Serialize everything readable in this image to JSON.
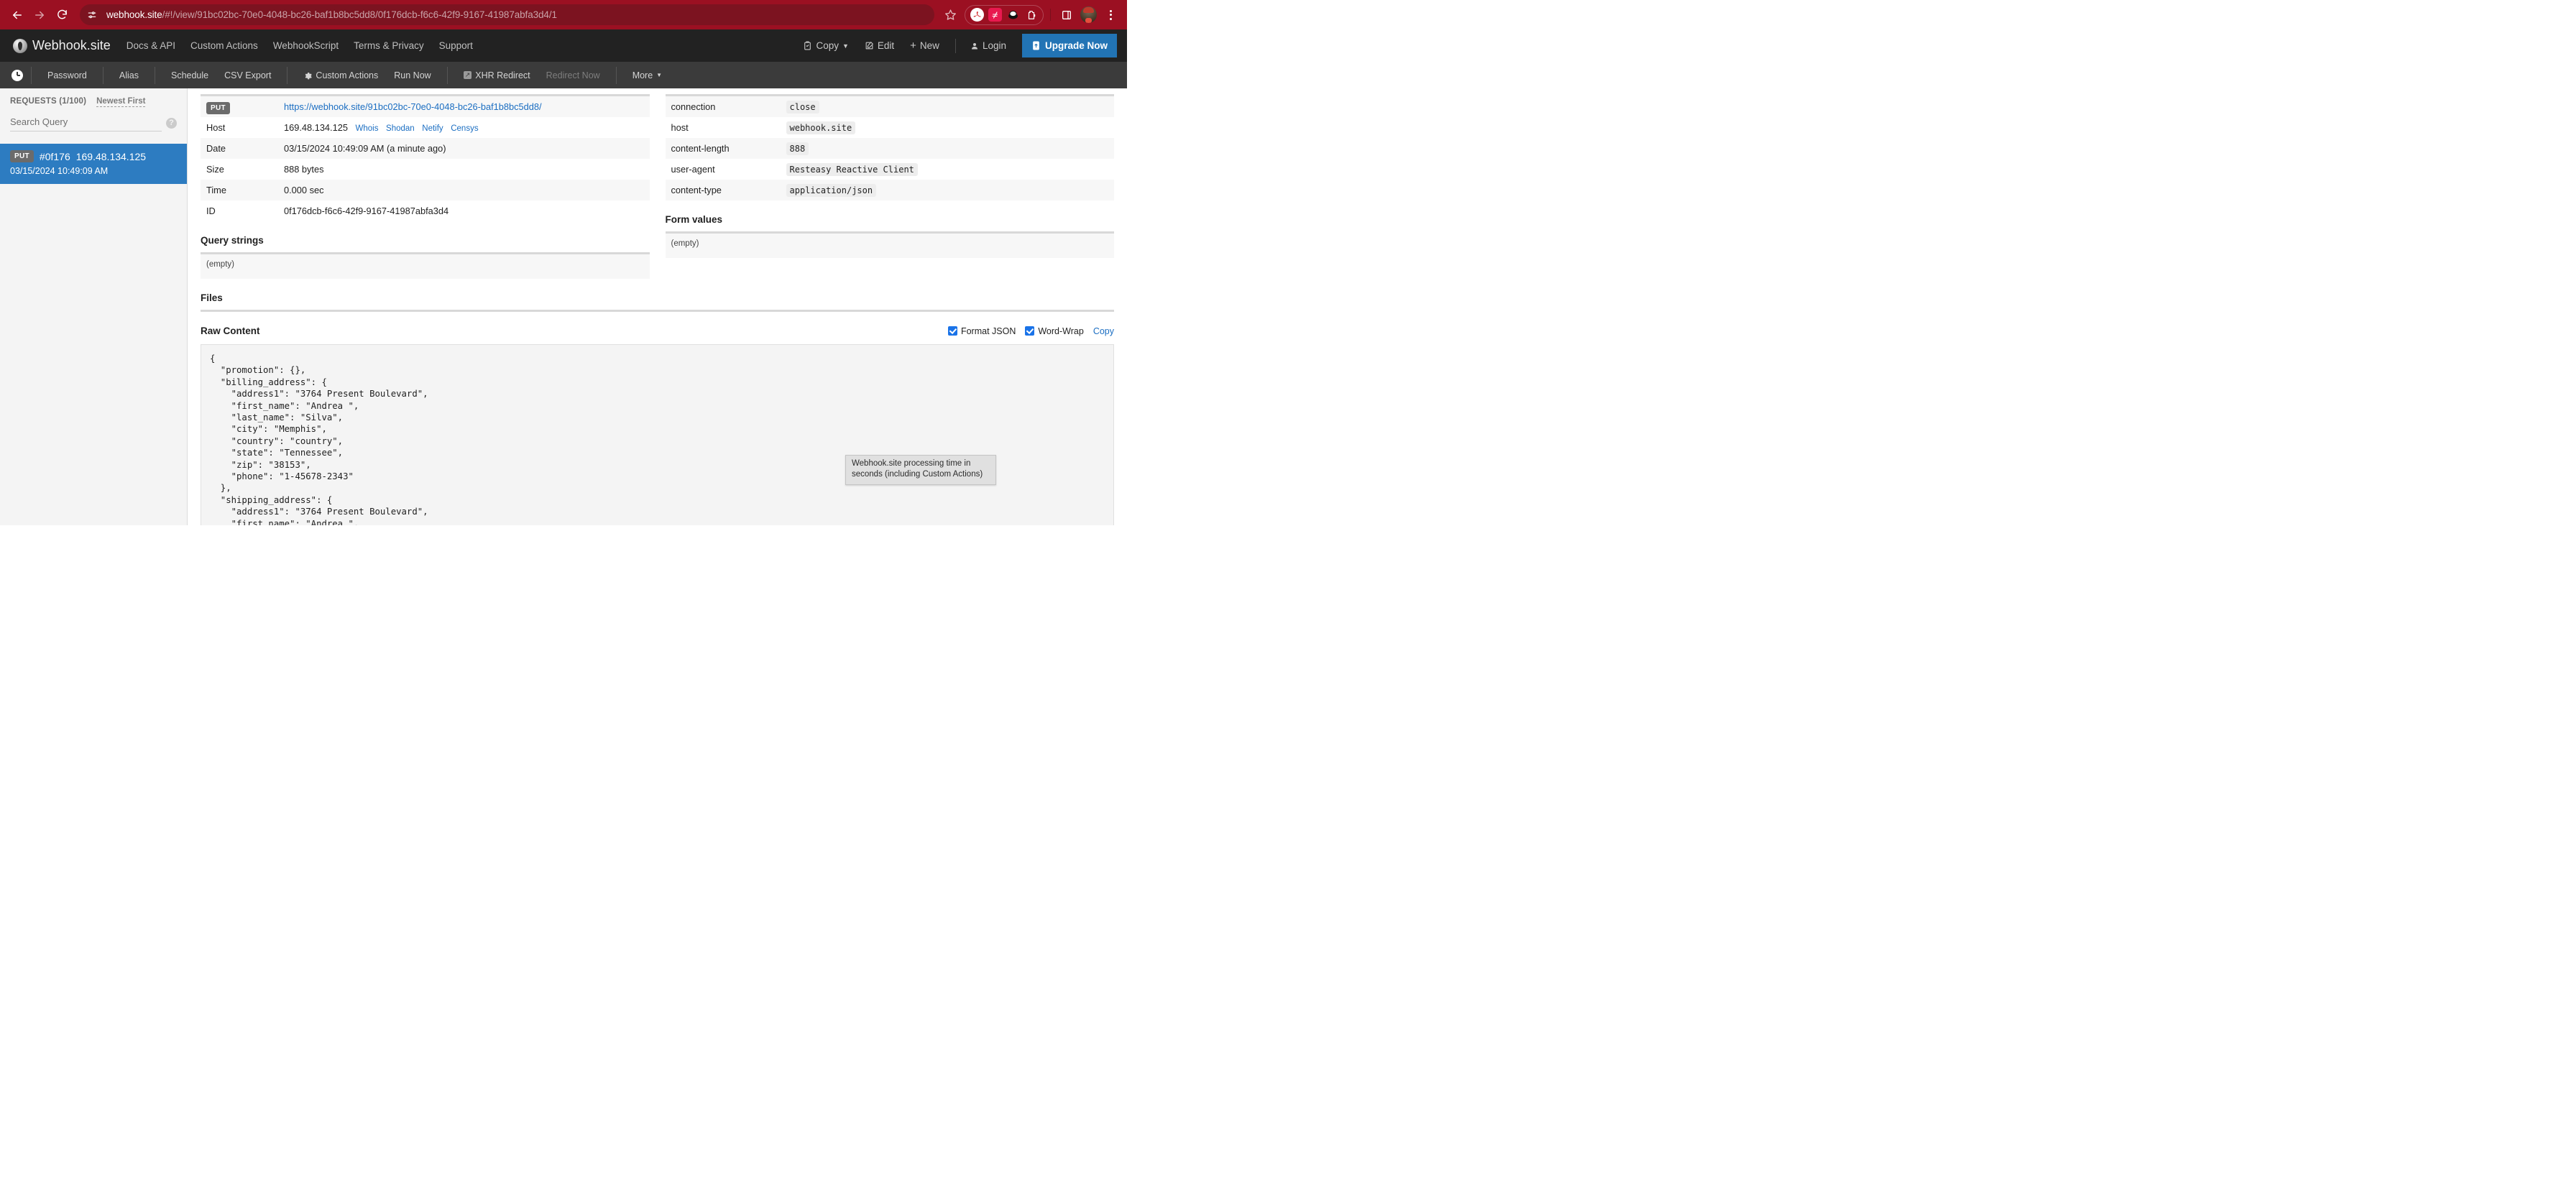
{
  "browser": {
    "back_icon": "back-arrow-icon",
    "forward_icon": "forward-arrow-icon",
    "reload_icon": "reload-icon",
    "site_info_icon": "site-settings-icon",
    "url_host": "webhook.site",
    "url_path": "/#!/view/91bc02bc-70e0-4048-bc26-baf1b8bc5dd8/0f176dcb-f6c6-42f9-9167-41987abfa3d4/1",
    "url_full": "webhook.site/#!/view/91bc02bc-70e0-4048-bc26-baf1b8bc5dd8/0f176dcb-f6c6-42f9-9167-41987abfa3d4/1",
    "star_icon": "bookmark-star-icon",
    "extensions": [
      {
        "name": "adobe-acrobat-extension-icon",
        "glyph": "✒"
      },
      {
        "name": "grammarly-extension-icon",
        "glyph": "≠"
      },
      {
        "name": "dark-reader-extension-icon",
        "glyph": "●"
      },
      {
        "name": "clipboard-extension-icon",
        "glyph": "⧉"
      }
    ],
    "side_panel_icon": "side-panel-icon",
    "avatar_name": "profile-avatar",
    "menu_icon": "chrome-menu-icon"
  },
  "header": {
    "brand": "Webhook.site",
    "nav": [
      {
        "label": "Docs & API"
      },
      {
        "label": "Custom Actions"
      },
      {
        "label": "WebhookScript"
      },
      {
        "label": "Terms & Privacy"
      },
      {
        "label": "Support"
      }
    ],
    "copy_label": "Copy",
    "edit_label": "Edit",
    "new_label": "New",
    "login_label": "Login",
    "upgrade_label": "Upgrade Now",
    "accent_blue": "#2274b5",
    "chrome_red": "#9b1022",
    "header_dark": "#222222"
  },
  "toolbar": {
    "clock_icon": "clock-icon",
    "items": [
      {
        "label": "Password",
        "disabled": false,
        "icon": ""
      },
      {
        "label": "Alias",
        "disabled": false,
        "icon": ""
      },
      {
        "label": "Schedule",
        "disabled": false,
        "icon": ""
      },
      {
        "label": "CSV Export",
        "disabled": false,
        "icon": ""
      },
      {
        "label": "Custom Actions",
        "disabled": false,
        "icon": "gear-icon"
      },
      {
        "label": "Run Now",
        "disabled": false,
        "icon": ""
      },
      {
        "label": "XHR Redirect",
        "disabled": false,
        "icon": "external-link-icon"
      },
      {
        "label": "Redirect Now",
        "disabled": true,
        "icon": ""
      },
      {
        "label": "More",
        "disabled": false,
        "icon": "caret-down-icon"
      }
    ]
  },
  "sidebar": {
    "requests_title": "REQUESTS (1/100)",
    "sort_toggle": "Newest First",
    "search_placeholder": "Search Query",
    "search_value": "",
    "help_icon": "help-icon",
    "requests": [
      {
        "method": "PUT",
        "id_short": "#0f176",
        "ip": "169.48.134.125",
        "timestamp": "03/15/2024 10:49:09 AM",
        "selected": true
      }
    ]
  },
  "details": {
    "method": "PUT",
    "url": "https://webhook.site/91bc02bc-70e0-4048-bc26-baf1b8bc5dd8/",
    "rows": [
      {
        "key": "Host",
        "value": "169.48.134.125",
        "links": [
          "Whois",
          "Shodan",
          "Netify",
          "Censys"
        ]
      },
      {
        "key": "Date",
        "value": "03/15/2024 10:49:09 AM (a minute ago)",
        "links": []
      },
      {
        "key": "Size",
        "value": "888 bytes",
        "links": []
      },
      {
        "key": "Time",
        "value": "0.000 sec",
        "links": []
      },
      {
        "key": "ID",
        "value": "0f176dcb-f6c6-42f9-9167-41987abfa3d4",
        "links": []
      }
    ]
  },
  "headers": {
    "rows": [
      {
        "key": "connection",
        "value": "close"
      },
      {
        "key": "host",
        "value": "webhook.site"
      },
      {
        "key": "content-length",
        "value": "888"
      },
      {
        "key": "user-agent",
        "value": "Resteasy Reactive Client"
      },
      {
        "key": "content-type",
        "value": "application/json"
      }
    ]
  },
  "sections": {
    "query_strings_title": "Query strings",
    "query_strings_empty": "(empty)",
    "form_values_title": "Form values",
    "form_values_empty": "(empty)",
    "files_title": "Files",
    "raw_content_title": "Raw Content",
    "format_json_label": "Format JSON",
    "format_json_checked": true,
    "word_wrap_label": "Word-Wrap",
    "word_wrap_checked": true,
    "copy_label": "Copy"
  },
  "raw_content": "{\n  \"promotion\": {},\n  \"billing_address\": {\n    \"address1\": \"3764 Present Boulevard\",\n    \"first_name\": \"Andrea \",\n    \"last_name\": \"Silva\",\n    \"city\": \"Memphis\",\n    \"country\": \"country\",\n    \"state\": \"Tennessee\",\n    \"zip\": \"38153\",\n    \"phone\": \"1-45678-2343\"\n  },\n  \"shipping_address\": {\n    \"address1\": \"3764 Present Boulevard\",\n    \"first_name\": \"Andrea \",\n    \"last_name\": \"Silva\",\n    \"city\": \"Memphis\",\n    \"country\": \"country\",\n    \"state\": \"Tennessee\",\n    \"zip\": \"38153\",\n    \"phone\": \"1-45678-2343\"\n  }",
  "tooltip": {
    "text": "Webhook.site processing time in seconds (including Custom Actions)"
  }
}
